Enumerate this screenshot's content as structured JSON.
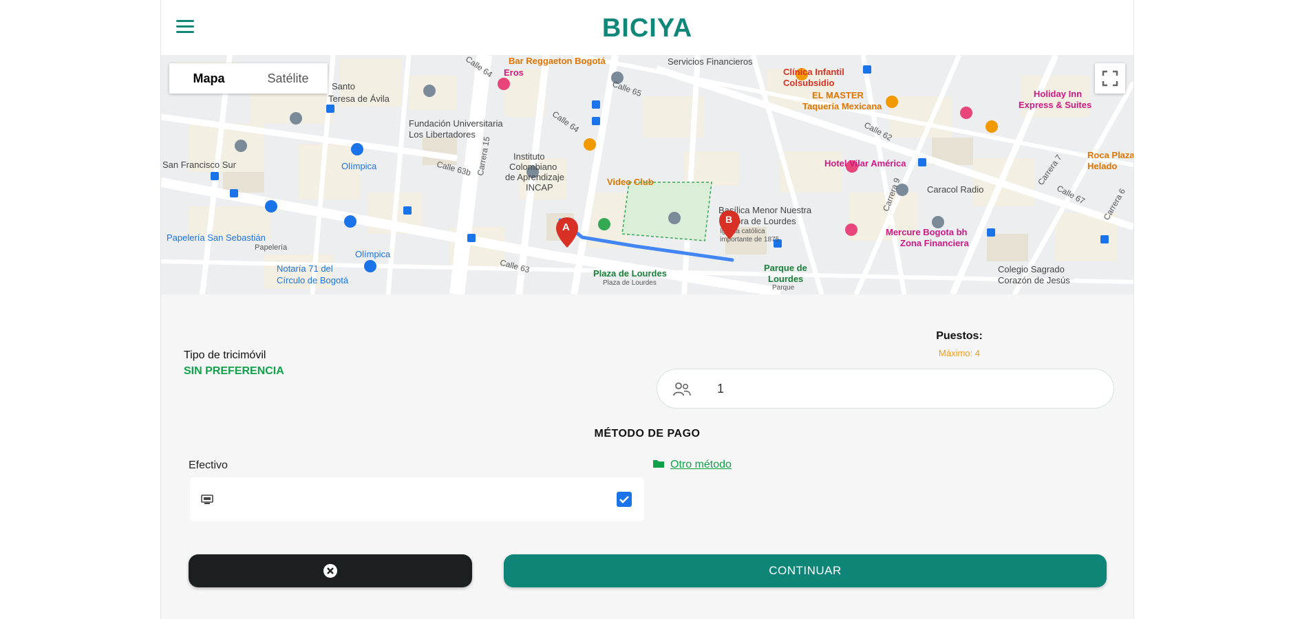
{
  "header": {
    "brand": "BICIYA"
  },
  "map": {
    "toggle": [
      "Mapa",
      "Satélite"
    ],
    "pois": {
      "bar_reggaeton": "Bar Reggaeton Bogotá",
      "eros": "Eros",
      "servicios": "Servicios Financieros",
      "clinica": "Clínica Infantil",
      "colsubsidio": "Colsubsidio",
      "el_master": "EL MASTER",
      "taqueria": "Taquería Mexicana",
      "holiday": "Holiday Inn",
      "express": "Express & Suites",
      "teresa": "Teresa de Ávila",
      "santo": "Santo",
      "fundacion": "Fundación Universitaria",
      "libertadores": "Los Libertadores",
      "instituto": "Instituto",
      "colombiano": "Colombiano",
      "aprendizaje": "de Aprendizaje",
      "incap": "INCAP",
      "video_club": "Video Club",
      "olimpica1": "Olímpica",
      "san_francisco": "San Francisco Sur",
      "hotel_vilar": "Hotel Vilar América",
      "roca": "Roca Plaza",
      "helado": "Helado",
      "caracol": "Caracol Radio",
      "basilica": "Basílica Menor Nuestra",
      "senora": "Señora de Lourdes",
      "iglesia": "Iglesia católica",
      "importante": "importante de 1875",
      "papeleria": "Papelería San Sebastián",
      "papeleria_sub": "Papelería",
      "olimpica2": "Olímpica",
      "mercure": "Mercure Bogota bh",
      "zona": "Zona Financiera",
      "notaria": "Notaría 71 del",
      "circulo": "Círculo de Bogotá",
      "plaza": "Plaza de Lourdes",
      "plaza_sub": "Plaza de Lourdes",
      "parque": "Parque de",
      "parque2": "Lourdes",
      "parque_sub": "Parque",
      "colegio": "Colegio Sagrado",
      "corazon": "Corazón de Jesús"
    },
    "streets": {
      "calle64_top": "Calle 64",
      "calle65": "Calle 65",
      "calle64": "Calle 64",
      "calle63b": "Calle 63b",
      "calle63": "Calle 63",
      "calle62": "Calle 62",
      "calle67": "Calle 67",
      "carrera15": "Carrera 15",
      "carrera9": "Carrera 9",
      "carrera7": "Carrera 7",
      "carrera6": "Carrera 6"
    },
    "markers": {
      "a": "A",
      "b": "B"
    }
  },
  "form": {
    "tipo_label": "Tipo de tricimóvil",
    "tipo_value": "SIN PREFERENCIA",
    "puestos_label": "Puestos:",
    "puestos_max": "Máximo: 4",
    "puestos_value": "1",
    "metodo_title": "MÉTODO DE PAGO",
    "efectivo_label": "Efectivo",
    "efectivo_checked": true,
    "otro_metodo": "Otro método"
  },
  "buttons": {
    "continue_label": "CONTINUAR"
  },
  "colors": {
    "brand": "#11877a",
    "continue": "#0f8577",
    "cancel": "#1b1f20",
    "accent_green": "#11a14a",
    "warning": "#f39c12",
    "checkbox": "#1a73e8"
  }
}
